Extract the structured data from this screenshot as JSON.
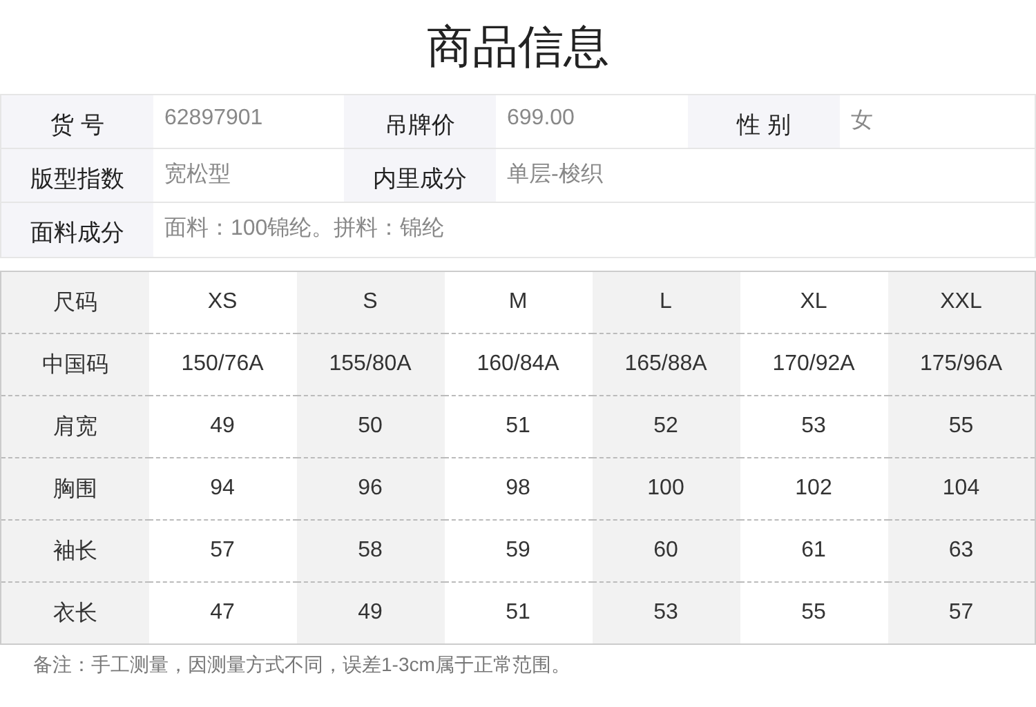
{
  "title": "商品信息",
  "info": [
    [
      {
        "label": "货 号",
        "value": "62897901"
      },
      {
        "label": "吊牌价",
        "value": "699.00"
      },
      {
        "label": "性 别",
        "value": "女"
      }
    ],
    [
      {
        "label": "版型指数",
        "value": "宽松型"
      },
      {
        "label": "内里成分",
        "value": "单层-梭织"
      }
    ],
    [
      {
        "label": "面料成分",
        "value": "面料：100锦纶。拼料：锦纶"
      }
    ]
  ],
  "size_table": {
    "columns": [
      "尺码",
      "XS",
      "S",
      "M",
      "L",
      "XL",
      "XXL"
    ],
    "rows": [
      {
        "label": "中国码",
        "values": [
          "150/76A",
          "155/80A",
          "160/84A",
          "165/88A",
          "170/92A",
          "175/96A"
        ]
      },
      {
        "label": "肩宽",
        "values": [
          "49",
          "50",
          "51",
          "52",
          "53",
          "55"
        ]
      },
      {
        "label": "胸围",
        "values": [
          "94",
          "96",
          "98",
          "100",
          "102",
          "104"
        ]
      },
      {
        "label": "袖长",
        "values": [
          "57",
          "58",
          "59",
          "60",
          "61",
          "63"
        ]
      },
      {
        "label": "衣长",
        "values": [
          "47",
          "49",
          "51",
          "53",
          "55",
          "57"
        ]
      }
    ]
  },
  "note": "备注：手工测量，因测量方式不同，误差1-3cm属于正常范围。"
}
